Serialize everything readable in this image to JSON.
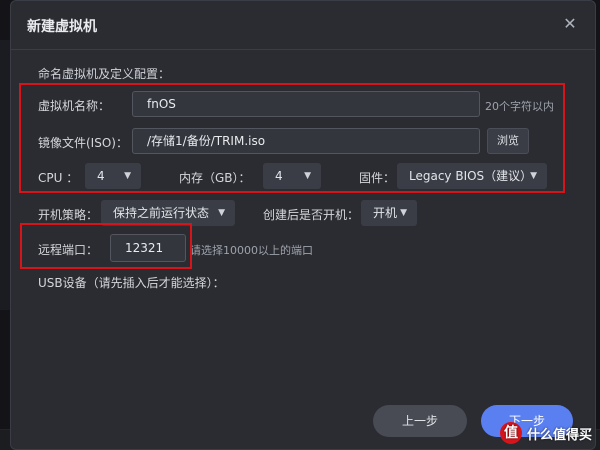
{
  "dialog": {
    "title": "新建虚拟机",
    "section_title": "命名虚拟机及定义配置："
  },
  "vm_name": {
    "label": "虚拟机名称：",
    "value": "fnOS",
    "hint": "20个字符以内"
  },
  "image_file": {
    "label": "镜像文件(ISO)：",
    "value": "/存储1/备份/TRIM.iso",
    "browse": "浏览"
  },
  "cpu": {
    "label": "CPU ：",
    "value": "4"
  },
  "memory": {
    "label": "内存（GB）：",
    "value": "4"
  },
  "firmware": {
    "label": "固件：",
    "value": "Legacy BIOS（建议）"
  },
  "power_policy": {
    "label": "开机策略：",
    "value": "保持之前运行状态"
  },
  "start_after_create": {
    "label": "创建后是否开机：",
    "value": "开机"
  },
  "remote_port": {
    "label": "远程端口：",
    "value": "12321",
    "hint": "请选择10000以上的端口"
  },
  "usb": {
    "label": "USB设备（请先插入后才能选择）："
  },
  "footer": {
    "prev": "上一步",
    "next": "下一步"
  },
  "icons": {
    "close": "close-icon",
    "caret": "chevron-down-icon"
  },
  "colors": {
    "accent": "#5a7ff0",
    "highlight_box": "#d8141b",
    "dialog_bg": "#2a2c32"
  },
  "watermark": {
    "logo": "值",
    "text": "什么值得买"
  }
}
